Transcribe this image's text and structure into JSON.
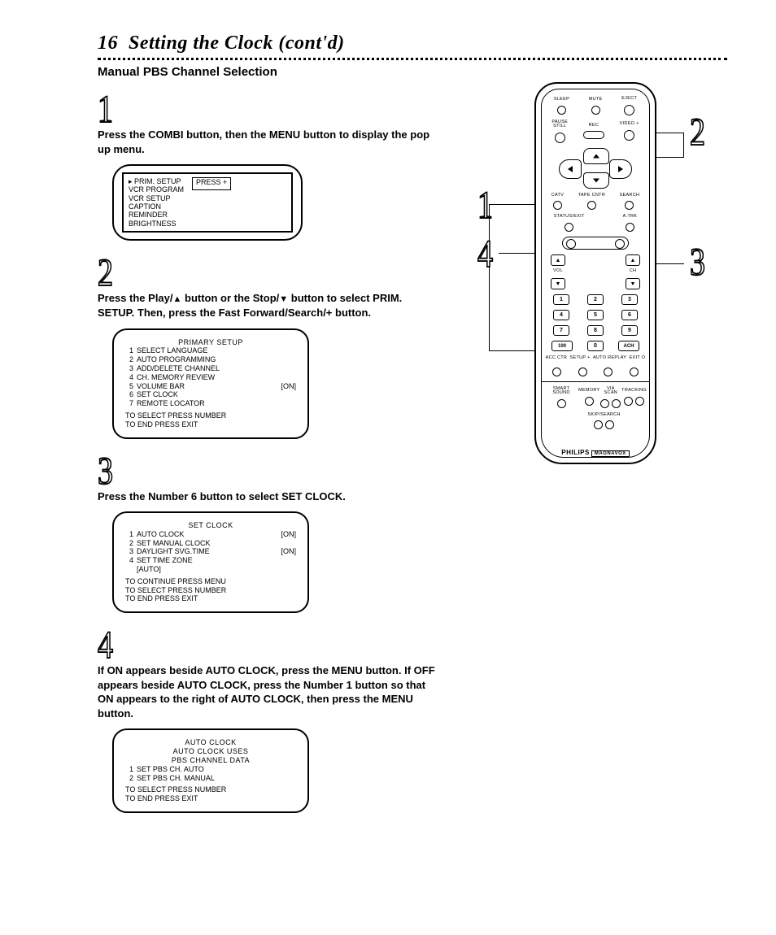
{
  "page": {
    "number": "16",
    "title": "Setting the Clock (cont'd)",
    "subhead": "Manual PBS Channel Selection"
  },
  "steps": {
    "s1": {
      "num": "1",
      "text_a": "Press the ",
      "combi": "COMBI",
      "text_b": " button, then the ",
      "menu": "MENU",
      "text_c": " button to display the pop up menu."
    },
    "s2": {
      "num": "2",
      "text_a": "Press the Play/",
      "text_b": " button or the Stop/",
      "text_c": " button to select ",
      "prim": "PRIM. SETUP.",
      "text_d": "Then, press the Fast Forward/Search/+ button."
    },
    "s3": {
      "num": "3",
      "text_a": "Press the Number 6 button to select ",
      "setclock": "SET CLOCK",
      "period": "."
    },
    "s4": {
      "num": "4",
      "text_a": "If ",
      "on1": "ON",
      "text_b": " appears beside ",
      "ac1": "AUTO CLOCK",
      "text_c": ", press the ",
      "menu1": "MENU",
      "text_d": " button. If ",
      "off": "OFF",
      "text_e": " appears beside ",
      "ac2": "AUTO CLOCK",
      "text_f": ", press the Number 1 button so that ",
      "on2": "ON",
      "text_g": " appears to the right of ",
      "ac3": "AUTO CLOCK",
      "text_h": ", then press the ",
      "menu2": "MENU",
      "text_i": " button."
    }
  },
  "osd1": {
    "items": [
      "▸ PRIM. SETUP",
      "VCR PROGRAM",
      "VCR SETUP",
      "CAPTION",
      "REMINDER",
      "BRIGHTNESS"
    ],
    "press": "PRESS +"
  },
  "osd2": {
    "title": "PRIMARY SETUP",
    "lines": [
      {
        "n": "1",
        "t": "SELECT LANGUAGE"
      },
      {
        "n": "2",
        "t": "AUTO PROGRAMMING"
      },
      {
        "n": "3",
        "t": "ADD/DELETE CHANNEL"
      },
      {
        "n": "4",
        "t": "CH. MEMORY REVIEW"
      },
      {
        "n": "5",
        "t": "VOLUME BAR",
        "r": "[ON]"
      },
      {
        "n": "6",
        "t": "SET CLOCK"
      },
      {
        "n": "7",
        "t": "REMOTE LOCATOR"
      }
    ],
    "foot1": "TO SELECT PRESS NUMBER",
    "foot2": "TO END PRESS EXIT"
  },
  "osd3": {
    "title": "SET CLOCK",
    "lines": [
      {
        "n": "1",
        "t": "AUTO CLOCK",
        "r": "[ON]"
      },
      {
        "n": "2",
        "t": "SET MANUAL CLOCK"
      },
      {
        "n": "3",
        "t": "DAYLIGHT SVG.TIME",
        "r": "[ON]"
      },
      {
        "n": "4",
        "t": "SET TIME ZONE"
      },
      {
        "n": "",
        "t": "[AUTO]"
      }
    ],
    "foot1": "TO CONTINUE PRESS MENU",
    "foot2": "TO SELECT PRESS NUMBER",
    "foot3": "TO END PRESS EXIT"
  },
  "osd4": {
    "title": "AUTO CLOCK",
    "sub1": "AUTO CLOCK USES",
    "sub2": "PBS CHANNEL DATA",
    "lines": [
      {
        "n": "1",
        "t": "SET PBS CH.   AUTO"
      },
      {
        "n": "2",
        "t": "SET PBS CH.   MANUAL"
      }
    ],
    "foot1": "TO SELECT PRESS NUMBER",
    "foot2": "TO END PRESS EXIT"
  },
  "remote": {
    "top_labels": [
      "SLEEP",
      "MUTE",
      "EJECT"
    ],
    "row2_labels": [
      "PAUSE\nSTILL",
      "REC",
      "VIDEO +"
    ],
    "small_row": [
      "CATV",
      "TAPE CNTR",
      "SEARCH"
    ],
    "small_row2": [
      "STATUS/EXIT",
      "",
      "A.TRK"
    ],
    "vol": "VOL",
    "ch": "CH",
    "keypad": [
      "1",
      "2",
      "3",
      "4",
      "5",
      "6",
      "7",
      "8",
      "9",
      "100",
      "0",
      "ACH"
    ],
    "mid_labels": [
      "ACC.CTR",
      "SETUP +",
      "AUTO REPLAY",
      "EXIT O"
    ],
    "bot_labels1": [
      "SMART SOUND",
      "MEMORY"
    ],
    "bot_labels2": [
      "VIA SCAN",
      "TRACKING"
    ],
    "skip": "SKIP/SEARCH",
    "brand": "PHILIPS",
    "brand_box": "MAGNAVOX"
  },
  "callouts": {
    "c1": "1",
    "c2": "2",
    "c3": "3",
    "c4": "4"
  }
}
